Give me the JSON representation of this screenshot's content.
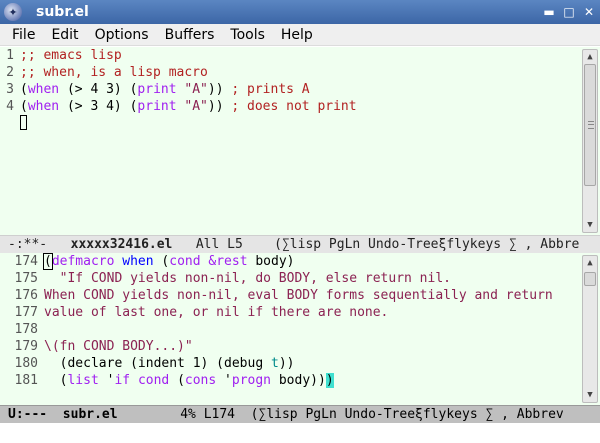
{
  "window": {
    "title": "subr.el",
    "controls": {
      "minimize": "▬",
      "maximize": "□",
      "close": "✕"
    }
  },
  "menu": [
    "File",
    "Edit",
    "Options",
    "Buffers",
    "Tools",
    "Help"
  ],
  "top_buffer": {
    "line_numbers": [
      "1",
      "2",
      "3",
      "4"
    ],
    "lines": [
      [
        {
          "t": ";; emacs lisp",
          "c": "comment"
        }
      ],
      [
        {
          "t": ";; when, is a lisp macro",
          "c": "comment"
        }
      ],
      [
        {
          "t": "(",
          "c": "plain"
        },
        {
          "t": "when",
          "c": "keyword"
        },
        {
          "t": " (> 4 3) (",
          "c": "plain"
        },
        {
          "t": "print",
          "c": "keyword"
        },
        {
          "t": " ",
          "c": "plain"
        },
        {
          "t": "\"A\"",
          "c": "string"
        },
        {
          "t": ")) ",
          "c": "plain"
        },
        {
          "t": "; prints A",
          "c": "comment"
        }
      ],
      [
        {
          "t": "(",
          "c": "plain"
        },
        {
          "t": "when",
          "c": "keyword"
        },
        {
          "t": " (> 3 4) (",
          "c": "plain"
        },
        {
          "t": "print",
          "c": "keyword"
        },
        {
          "t": " ",
          "c": "plain"
        },
        {
          "t": "\"A\"",
          "c": "string"
        },
        {
          "t": ")) ",
          "c": "plain"
        },
        {
          "t": "; does not print",
          "c": "comment"
        }
      ]
    ],
    "modeline": {
      "status": "-:**-",
      "buffer": "xxxxx32416.el",
      "position": "All L5",
      "modes": "(∑lisp PgLn Undo-Treeξflykeys ∑ , Abbre"
    }
  },
  "bottom_buffer": {
    "line_numbers": [
      "174",
      "175",
      "176",
      "177",
      "178",
      "179",
      "180",
      "181"
    ],
    "lines": [
      [
        {
          "t": "(",
          "c": "paren-ol"
        },
        {
          "t": "defmacro",
          "c": "keyword"
        },
        {
          "t": " ",
          "c": "plain"
        },
        {
          "t": "when",
          "c": "func"
        },
        {
          "t": " (",
          "c": "plain"
        },
        {
          "t": "cond",
          "c": "keyword"
        },
        {
          "t": " ",
          "c": "plain"
        },
        {
          "t": "&rest",
          "c": "keyword"
        },
        {
          "t": " body)",
          "c": "plain"
        }
      ],
      [
        {
          "t": "  \"If COND yields non-nil, do BODY, else return nil.",
          "c": "string"
        }
      ],
      [
        {
          "t": "When COND yields non-nil, eval BODY forms sequentially and return",
          "c": "string"
        }
      ],
      [
        {
          "t": "value of last one, or nil if there are none.",
          "c": "string"
        }
      ],
      [
        {
          "t": "",
          "c": "plain"
        }
      ],
      [
        {
          "t": "\\(fn COND BODY...)\"",
          "c": "string"
        }
      ],
      [
        {
          "t": "  (declare (indent 1) (debug ",
          "c": "plain"
        },
        {
          "t": "t",
          "c": "const"
        },
        {
          "t": "))",
          "c": "plain"
        }
      ],
      [
        {
          "t": "  (",
          "c": "plain"
        },
        {
          "t": "list",
          "c": "keyword"
        },
        {
          "t": " '",
          "c": "plain"
        },
        {
          "t": "if",
          "c": "keyword"
        },
        {
          "t": " ",
          "c": "plain"
        },
        {
          "t": "cond",
          "c": "keyword"
        },
        {
          "t": " (",
          "c": "plain"
        },
        {
          "t": "cons",
          "c": "keyword"
        },
        {
          "t": " '",
          "c": "plain"
        },
        {
          "t": "progn",
          "c": "keyword"
        },
        {
          "t": " body))",
          "c": "plain"
        },
        {
          "t": ")",
          "c": "paren-hl"
        }
      ]
    ],
    "modeline": {
      "status": "U:---",
      "buffer": "subr.el",
      "position": "4% L174",
      "modes": "(∑lisp PgLn Undo-Treeξflykeys ∑ , Abbrev"
    }
  },
  "icons": {
    "app": "gnu-emacs-icon",
    "scroll_up": "▲",
    "scroll_down": "▼"
  }
}
